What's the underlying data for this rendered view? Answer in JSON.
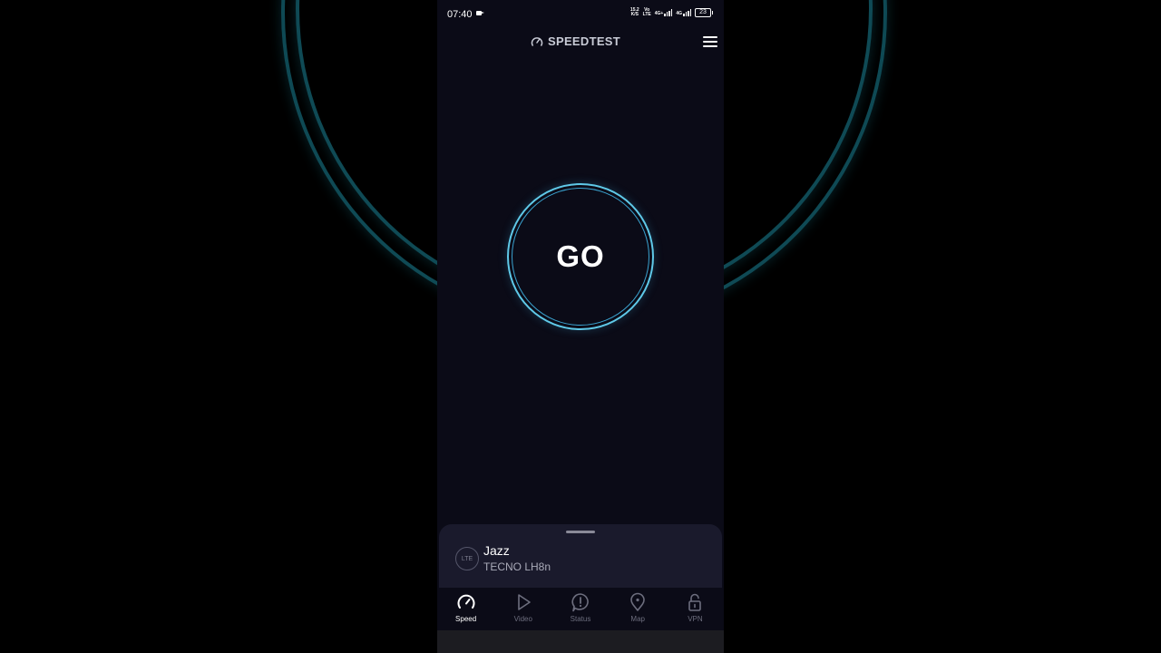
{
  "status_bar": {
    "time": "07:40",
    "speed_value": "15.2",
    "speed_unit": "K/S",
    "volte_top": "Vo",
    "volte_bottom": "LTE",
    "net1": "4G+",
    "net2": "4G",
    "battery": "23"
  },
  "header": {
    "title": "SPEEDTEST"
  },
  "main": {
    "go_label": "GO"
  },
  "connection": {
    "badge": "LTE",
    "carrier": "Jazz",
    "device": "TECNO LH8n"
  },
  "tabs": [
    {
      "label": "Speed",
      "icon": "speedometer-icon",
      "active": true
    },
    {
      "label": "Video",
      "icon": "play-icon",
      "active": false
    },
    {
      "label": "Status",
      "icon": "alert-icon",
      "active": false
    },
    {
      "label": "Map",
      "icon": "map-pin-icon",
      "active": false
    },
    {
      "label": "VPN",
      "icon": "lock-icon",
      "active": false
    }
  ],
  "colors": {
    "background": "#0b0b17",
    "accent_ring": "#5fc9e8",
    "sheet": "#1a1a2c",
    "inactive_tab": "#6d6e7e"
  }
}
